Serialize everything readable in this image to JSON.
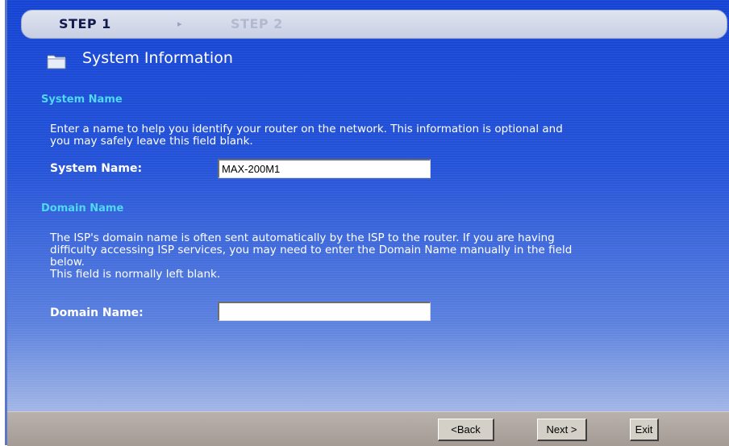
{
  "wizard": {
    "steps": [
      {
        "label": "STEP 1",
        "active": true
      },
      {
        "label": "STEP 2",
        "active": false
      }
    ],
    "step_separator": "▸"
  },
  "page": {
    "title": "System Information",
    "title_icon": "folder-icon"
  },
  "system_name_section": {
    "heading": "System Name",
    "description_lines": [
      "Enter a name to help you identify your router on the network. This information is optional and",
      "you may safely leave this field blank."
    ],
    "field_label": "System Name:",
    "field_value": "MAX-200M1"
  },
  "domain_name_section": {
    "heading": "Domain Name",
    "description_lines": [
      "The ISP's domain name is often sent automatically by the ISP to the router. If you are having",
      "difficulty accessing ISP services, you may need to enter the Domain Name manually in the field",
      "below.",
      "This field is normally left blank."
    ],
    "field_label": "Domain Name:",
    "field_value": ""
  },
  "buttons": {
    "back": "<Back",
    "next": "Next >",
    "exit": "Exit"
  },
  "colors": {
    "background_top": "#1544d4",
    "section_heading": "#4fd8f2",
    "text": "#ffffff",
    "bottom_bar": "#a39b94"
  }
}
